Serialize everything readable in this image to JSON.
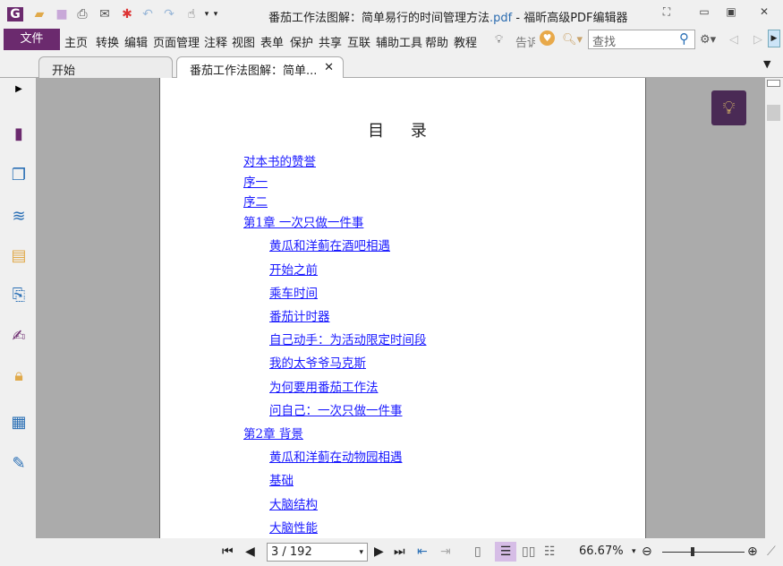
{
  "titlebar": {
    "title_main": "番茄工作法图解：简单易行的时间管理方法",
    "title_ext": ".pdf",
    "title_app": " - 福昕高级PDF编辑器"
  },
  "menu": {
    "file": "文件",
    "items": [
      "主页",
      "转换",
      "编辑",
      "页面管理",
      "注释",
      "视图",
      "表单",
      "保护",
      "共享",
      "互联",
      "辅助工具",
      "帮助",
      "教程"
    ],
    "tell": "告诉",
    "search_placeholder": "查找"
  },
  "tabs": [
    {
      "label": "开始"
    },
    {
      "label": "番茄工作法图解：简单..."
    }
  ],
  "document": {
    "toc_title": "目 录",
    "entries": [
      {
        "text": "对本书的赞誉",
        "level": 0
      },
      {
        "text": "序一",
        "level": 0
      },
      {
        "text": "序二",
        "level": 0
      },
      {
        "text": "第1章 一次只做一件事",
        "level": 0
      },
      {
        "text": "黄瓜和洋蓟在酒吧相遇",
        "level": 1
      },
      {
        "text": "开始之前",
        "level": 1
      },
      {
        "text": "乘车时间",
        "level": 1
      },
      {
        "text": "番茄计时器",
        "level": 1
      },
      {
        "text": "自己动手：为活动限定时间段",
        "level": 1
      },
      {
        "text": "我的太爷爷马克斯",
        "level": 1
      },
      {
        "text": "为何要用番茄工作法",
        "level": 1
      },
      {
        "text": "问自己：一次只做一件事",
        "level": 1
      },
      {
        "text": "第2章 背景",
        "level": 0
      },
      {
        "text": "黄瓜和洋蓟在动物园相遇",
        "level": 1
      },
      {
        "text": "基础",
        "level": 1
      },
      {
        "text": "大脑结构",
        "level": 1
      },
      {
        "text": "大脑性能",
        "level": 1
      }
    ]
  },
  "status": {
    "page": "3 / 192",
    "zoom": "66.67%",
    "zoom_slider_fraction": 0.35
  },
  "colors": {
    "accent": "#6b2a6e",
    "link": "#1a1aff"
  }
}
